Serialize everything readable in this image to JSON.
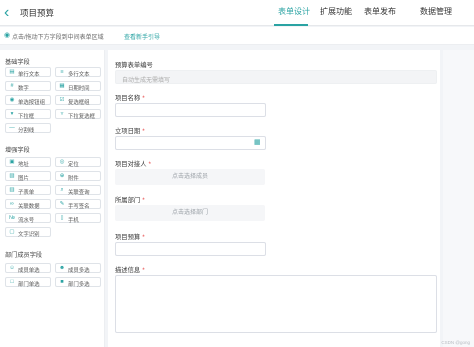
{
  "header": {
    "title": "项目预算",
    "tabs": [
      {
        "label": "表单设计",
        "active": true
      },
      {
        "label": "扩展功能",
        "active": false
      },
      {
        "label": "表单发布",
        "active": false
      },
      {
        "label": "数据管理",
        "active": false
      }
    ]
  },
  "hint": {
    "text": "点击/拖动下方字段到中间表单区域",
    "link": "查看新手引导"
  },
  "sidebar": {
    "groups": [
      {
        "title": "基础字段",
        "items": [
          {
            "label": "单行文本",
            "icon": "single-line-icon"
          },
          {
            "label": "多行文本",
            "icon": "multi-line-icon"
          },
          {
            "label": "数字",
            "icon": "number-icon"
          },
          {
            "label": "日期时间",
            "icon": "datetime-icon"
          },
          {
            "label": "单选按钮组",
            "icon": "radio-icon"
          },
          {
            "label": "复选框组",
            "icon": "checkbox-icon"
          },
          {
            "label": "下拉框",
            "icon": "dropdown-icon"
          },
          {
            "label": "下拉复选框",
            "icon": "multi-dropdown-icon"
          },
          {
            "label": "分割线",
            "icon": "divider-icon"
          }
        ]
      },
      {
        "title": "增强字段",
        "items": [
          {
            "label": "地址",
            "icon": "address-icon"
          },
          {
            "label": "定位",
            "icon": "location-icon"
          },
          {
            "label": "图片",
            "icon": "image-icon"
          },
          {
            "label": "附件",
            "icon": "attachment-icon"
          },
          {
            "label": "子表单",
            "icon": "subform-icon"
          },
          {
            "label": "关联查询",
            "icon": "link-query-icon"
          },
          {
            "label": "关联数据",
            "icon": "link-data-icon"
          },
          {
            "label": "手写签名",
            "icon": "signature-icon"
          },
          {
            "label": "流水号",
            "icon": "serial-icon"
          },
          {
            "label": "手机",
            "icon": "phone-icon"
          },
          {
            "label": "文字识别",
            "icon": "ocr-icon"
          }
        ]
      },
      {
        "title": "部门成员字段",
        "items": [
          {
            "label": "成员单选",
            "icon": "member-single-icon"
          },
          {
            "label": "成员多选",
            "icon": "member-multi-icon"
          },
          {
            "label": "部门单选",
            "icon": "dept-single-icon"
          },
          {
            "label": "部门多选",
            "icon": "dept-multi-icon"
          }
        ]
      }
    ]
  },
  "form": {
    "fields": [
      {
        "label": "预算表单编号",
        "required": false,
        "placeholder": "自动生成无需填写"
      },
      {
        "label": "项目名称",
        "required": true,
        "placeholder": ""
      },
      {
        "label": "立项日期",
        "required": true,
        "placeholder": ""
      },
      {
        "label": "项目对接人",
        "required": true,
        "placeholder": "点击选择成员"
      },
      {
        "label": "所属部门",
        "required": true,
        "placeholder": "点击选择部门"
      },
      {
        "label": "项目预算",
        "required": true,
        "placeholder": ""
      },
      {
        "label": "描述信息",
        "required": true,
        "placeholder": ""
      }
    ],
    "required_mark": "*"
  },
  "watermark": "CSDN @gong",
  "colors": {
    "accent": "#2aa3a3",
    "required": "#e64545"
  }
}
